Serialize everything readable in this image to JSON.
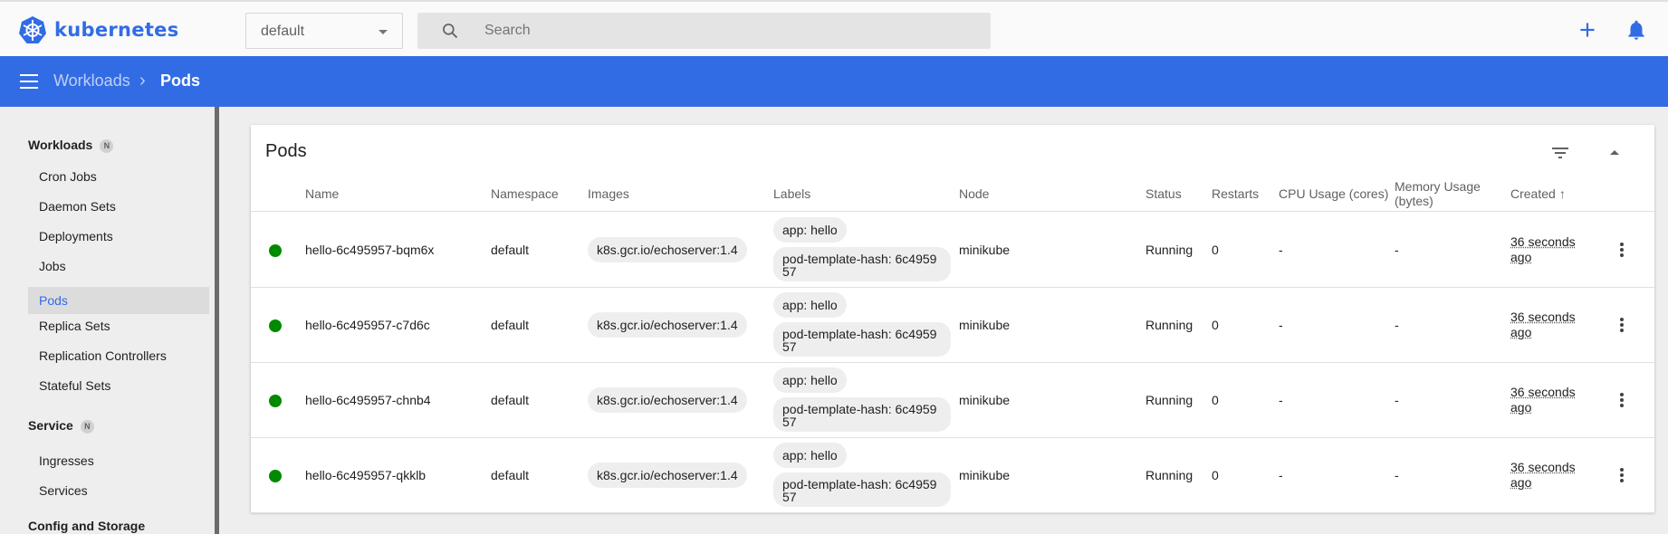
{
  "brand": {
    "name": "kubernetes",
    "color": "#326ce5"
  },
  "topbar": {
    "namespace": "default",
    "search_placeholder": "Search",
    "icons": [
      "search-icon",
      "add-icon",
      "bell-icon"
    ]
  },
  "breadcrumb": {
    "parent": "Workloads",
    "separator": "›",
    "current": "Pods"
  },
  "sidebar": {
    "sections": [
      {
        "title": "Workloads",
        "badge": "N"
      },
      {
        "title": "Service",
        "badge": "N"
      },
      {
        "title": "Config and Storage"
      }
    ],
    "workloads_items": [
      "Cron Jobs",
      "Daemon Sets",
      "Deployments",
      "Jobs",
      "Pods",
      "Replica Sets",
      "Replication Controllers",
      "Stateful Sets"
    ],
    "service_items": [
      "Ingresses",
      "Services"
    ],
    "active_item": "Pods"
  },
  "card": {
    "title": "Pods",
    "columns": {
      "name": "Name",
      "namespace": "Namespace",
      "images": "Images",
      "labels": "Labels",
      "node": "Node",
      "status": "Status",
      "restarts": "Restarts",
      "cpu": "CPU Usage (cores)",
      "memory_line1": "Memory Usage",
      "memory_line2": "(bytes)",
      "created": "Created",
      "sort_indicator": "↑"
    },
    "rows": [
      {
        "name": "hello-6c495957-bqm6x",
        "namespace": "default",
        "image": "k8s.gcr.io/echoserver:1.4",
        "label1": "app: hello",
        "label2_line1": "pod-template-hash: 6c4959",
        "label2_line2": "57",
        "node": "minikube",
        "status": "Running",
        "restarts": "0",
        "cpu": "-",
        "memory": "-",
        "created_line1": "36 seconds",
        "created_line2": "ago"
      },
      {
        "name": "hello-6c495957-c7d6c",
        "namespace": "default",
        "image": "k8s.gcr.io/echoserver:1.4",
        "label1": "app: hello",
        "label2_line1": "pod-template-hash: 6c4959",
        "label2_line2": "57",
        "node": "minikube",
        "status": "Running",
        "restarts": "0",
        "cpu": "-",
        "memory": "-",
        "created_line1": "36 seconds",
        "created_line2": "ago"
      },
      {
        "name": "hello-6c495957-chnb4",
        "namespace": "default",
        "image": "k8s.gcr.io/echoserver:1.4",
        "label1": "app: hello",
        "label2_line1": "pod-template-hash: 6c4959",
        "label2_line2": "57",
        "node": "minikube",
        "status": "Running",
        "restarts": "0",
        "cpu": "-",
        "memory": "-",
        "created_line1": "36 seconds",
        "created_line2": "ago"
      },
      {
        "name": "hello-6c495957-qkklb",
        "namespace": "default",
        "image": "k8s.gcr.io/echoserver:1.4",
        "label1": "app: hello",
        "label2_line1": "pod-template-hash: 6c4959",
        "label2_line2": "57",
        "node": "minikube",
        "status": "Running",
        "restarts": "0",
        "cpu": "-",
        "memory": "-",
        "created_line1": "36 seconds",
        "created_line2": "ago"
      }
    ]
  },
  "colors": {
    "nav": "#326ce5",
    "running": "#008a00"
  }
}
